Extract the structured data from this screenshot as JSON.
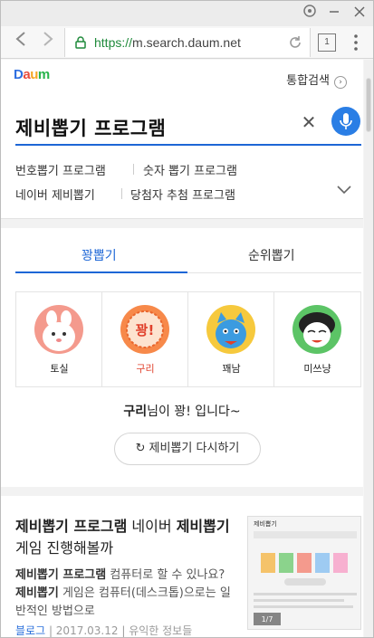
{
  "browser": {
    "url_scheme": "https://",
    "url_host": "m.search.daum.net",
    "tab_count": "1"
  },
  "header": {
    "logo": [
      "D",
      "a",
      "u",
      "m"
    ],
    "total_search": "통합검색"
  },
  "search": {
    "query": "제비뽑기 프로그램"
  },
  "related": [
    "번호뽑기 프로그램",
    "숫자 뽑기 프로그램",
    "네이버 제비뽑기",
    "당첨자 추첨 프로그램"
  ],
  "lottery": {
    "tabs": [
      "꽝뽑기",
      "순위뽑기"
    ],
    "active_tab": 0,
    "candidates": [
      {
        "name": "토실",
        "color": "#f49a8d"
      },
      {
        "name": "구리",
        "color": "#f7894a"
      },
      {
        "name": "꽤남",
        "color": "#f6c93d"
      },
      {
        "name": "미쓰냥",
        "color": "#5cc466"
      }
    ],
    "winner_index": 1,
    "result_name": "구리",
    "result_suffix": "님이 꽝! 입니다~",
    "retry_label": "제비뽑기 다시하기",
    "ggwang_badge": "꽝!"
  },
  "document": {
    "title_1": "제비뽑기 프로그램",
    "title_2": " 네이버 ",
    "title_3": "제비뽑기",
    "title_4": " 게임 진행해볼까",
    "body_1": "제비뽑기 프로그램",
    "body_2": " 컴퓨터로 할 수 있나요? ",
    "body_3": "제비뽑기",
    "body_4": " 게임은 컴퓨터(데스크톱)으로는 일반적인 방법으로",
    "source": "블로그",
    "date": "2017.03.12",
    "blog_name": "유익한 정보들",
    "thumb_header": "제비뽑기",
    "thumb_count": "1/7"
  },
  "colors": {
    "accent": "#1d66d6",
    "mic": "#2a7ee5",
    "winner_text": "#e0402b"
  }
}
